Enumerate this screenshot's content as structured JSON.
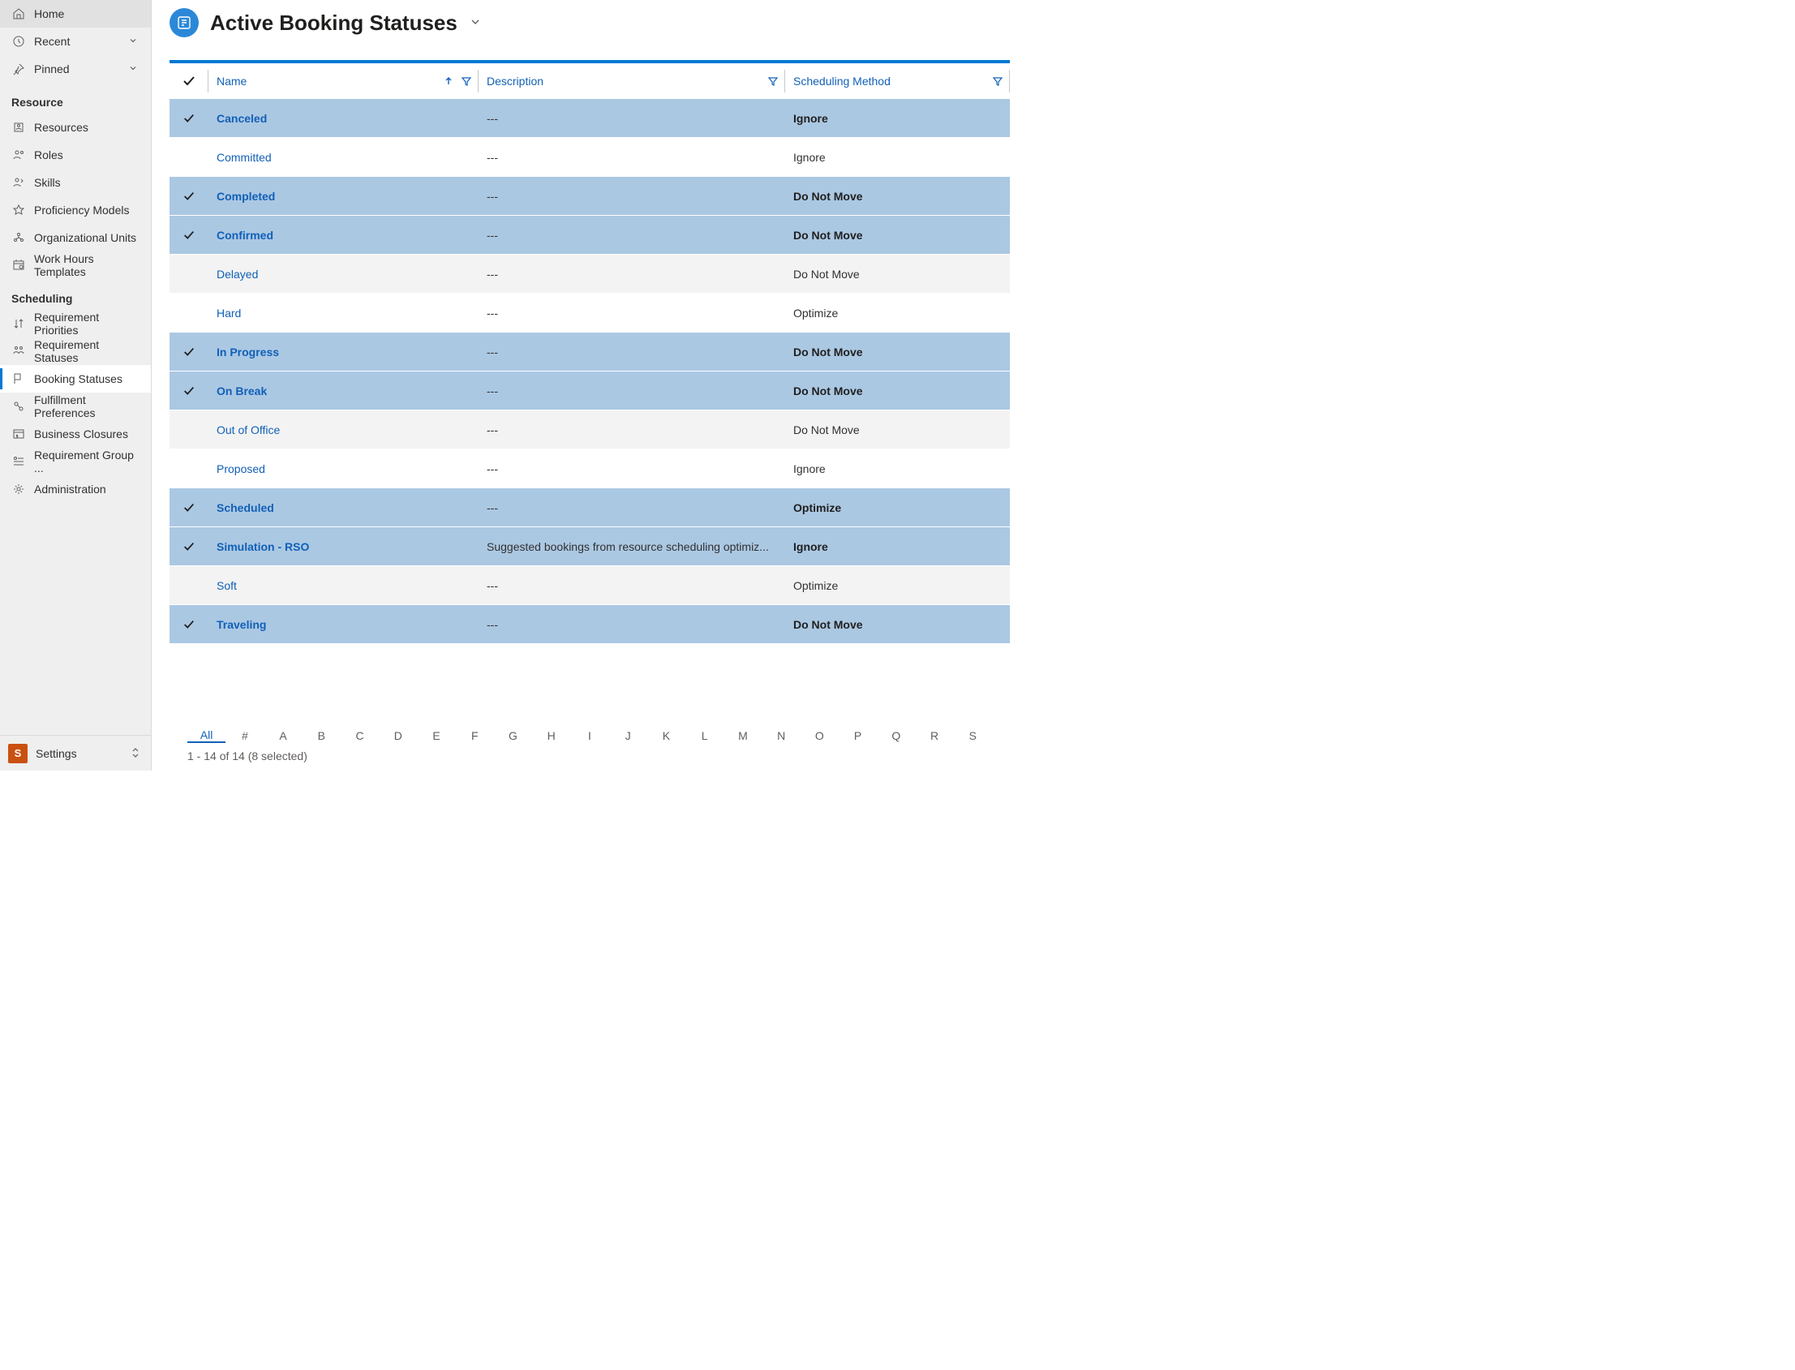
{
  "nav": {
    "home": "Home",
    "recent": "Recent",
    "pinned": "Pinned",
    "groups": {
      "resource": {
        "title": "Resource",
        "items": [
          "Resources",
          "Roles",
          "Skills",
          "Proficiency Models",
          "Organizational Units",
          "Work Hours Templates"
        ]
      },
      "scheduling": {
        "title": "Scheduling",
        "items": [
          "Requirement Priorities",
          "Requirement Statuses",
          "Booking Statuses",
          "Fulfillment Preferences",
          "Business Closures",
          "Requirement Group ...",
          "Administration"
        ]
      }
    }
  },
  "footer": {
    "abbr": "S",
    "label": "Settings"
  },
  "header": {
    "title": "Active Booking Statuses"
  },
  "columns": {
    "name": "Name",
    "description": "Description",
    "method": "Scheduling Method"
  },
  "rows": [
    {
      "selected": true,
      "name": "Canceled",
      "desc": "---",
      "method": "Ignore"
    },
    {
      "selected": false,
      "name": "Committed",
      "desc": "---",
      "method": "Ignore"
    },
    {
      "selected": true,
      "name": "Completed",
      "desc": "---",
      "method": "Do Not Move"
    },
    {
      "selected": true,
      "name": "Confirmed",
      "desc": "---",
      "method": "Do Not Move"
    },
    {
      "selected": false,
      "name": "Delayed",
      "desc": "---",
      "method": "Do Not Move"
    },
    {
      "selected": false,
      "name": "Hard",
      "desc": "---",
      "method": "Optimize"
    },
    {
      "selected": true,
      "name": "In Progress",
      "desc": "---",
      "method": "Do Not Move"
    },
    {
      "selected": true,
      "name": "On Break",
      "desc": "---",
      "method": "Do Not Move"
    },
    {
      "selected": false,
      "name": "Out of Office",
      "desc": "---",
      "method": "Do Not Move"
    },
    {
      "selected": false,
      "name": "Proposed",
      "desc": "---",
      "method": "Ignore"
    },
    {
      "selected": true,
      "name": "Scheduled",
      "desc": "---",
      "method": "Optimize"
    },
    {
      "selected": true,
      "name": "Simulation - RSO",
      "desc": "Suggested bookings from resource scheduling optimiz...",
      "method": "Ignore"
    },
    {
      "selected": false,
      "name": "Soft",
      "desc": "---",
      "method": "Optimize"
    },
    {
      "selected": true,
      "name": "Traveling",
      "desc": "---",
      "method": "Do Not Move"
    }
  ],
  "alpha": {
    "items": [
      "All",
      "#",
      "A",
      "B",
      "C",
      "D",
      "E",
      "F",
      "G",
      "H",
      "I",
      "J",
      "K",
      "L",
      "M",
      "N",
      "O",
      "P",
      "Q",
      "R",
      "S"
    ],
    "active": "All"
  },
  "status": "1 - 14 of 14 (8 selected)"
}
